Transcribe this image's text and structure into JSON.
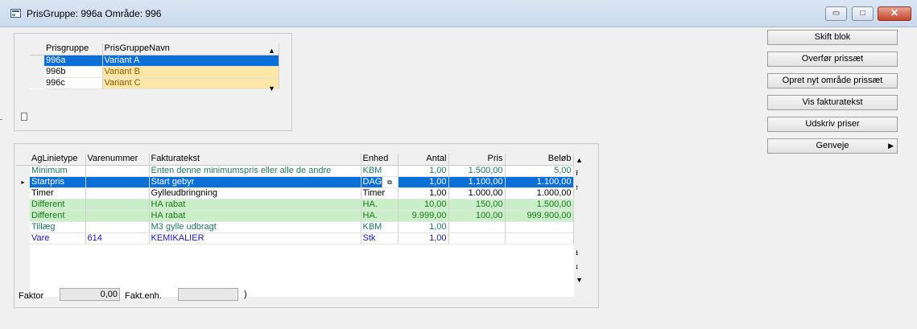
{
  "window": {
    "title": "PrisGruppe: 996a Område: 996",
    "minimize_glyph": "▭",
    "maximize_glyph": "□",
    "close_glyph": "✕"
  },
  "pris_grid": {
    "headers": [
      "Prisgruppe",
      "PrisGruppeNavn"
    ],
    "rows": [
      {
        "gruppe": "996a",
        "navn": "Variant A"
      },
      {
        "gruppe": "996b",
        "navn": "Variant B"
      },
      {
        "gruppe": "996c",
        "navn": "Variant C"
      }
    ]
  },
  "lines_grid": {
    "headers": [
      "AgLinietype",
      "Varenummer",
      "Fakturatekst",
      "Enhed",
      "Antal",
      "Pris",
      "Beløb"
    ],
    "row_pointer": "▸",
    "dropdown_glyph": "⧉",
    "rows": [
      {
        "type": "Minimum",
        "varenr": "",
        "tekst": "Enten denne minimumspris eller alle de andre",
        "enhed": "KBM",
        "antal": "1,00",
        "pris": "1.500,00",
        "belob": "5,00"
      },
      {
        "type": "Startpris",
        "varenr": "",
        "tekst": "Start gebyr",
        "enhed": "DAG",
        "antal": "1,00",
        "pris": "1.100,00",
        "belob": "1.100,00"
      },
      {
        "type": "Timer",
        "varenr": "",
        "tekst": "Gylleudbringning",
        "enhed": "Timer",
        "antal": "1,00",
        "pris": "1.000,00",
        "belob": "1.000,00"
      },
      {
        "type": "Different",
        "varenr": "",
        "tekst": "HA rabat",
        "enhed": "HA.",
        "antal": "10,00",
        "pris": "150,00",
        "belob": "1.500,00"
      },
      {
        "type": "Different",
        "varenr": "",
        "tekst": "HA rabat",
        "enhed": "HA.",
        "antal": "9.999,00",
        "pris": "100,00",
        "belob": "999.900,00"
      },
      {
        "type": "Tillæg",
        "varenr": "",
        "tekst": "M3 gylle udbragt",
        "enhed": "KBM",
        "antal": "1,00",
        "pris": "",
        "belob": ""
      },
      {
        "type": "Vare",
        "varenr": "614",
        "tekst": "KEMIKALIER",
        "enhed": "Stk",
        "antal": "1,00",
        "pris": "",
        "belob": ""
      }
    ]
  },
  "footer": {
    "faktor_label": "Faktor",
    "faktor_value": "0,00",
    "faktenh_label": "Fakt.enh.",
    "faktenh_value": ""
  },
  "side_buttons": {
    "skift_blok": "Skift blok",
    "overfor": "Overfør prissæt",
    "opret": "Opret nyt område prissæt",
    "vis": "Vis fakturatekst",
    "udskriv": "Udskriv priser",
    "genveje": "Genveje",
    "genveje_arrow": "▶"
  },
  "scroll_glyphs": {
    "up": "▲",
    "down": "▼",
    "first": "⭱",
    "prev": "⭫",
    "next": "⭭",
    "last": "⭳"
  }
}
